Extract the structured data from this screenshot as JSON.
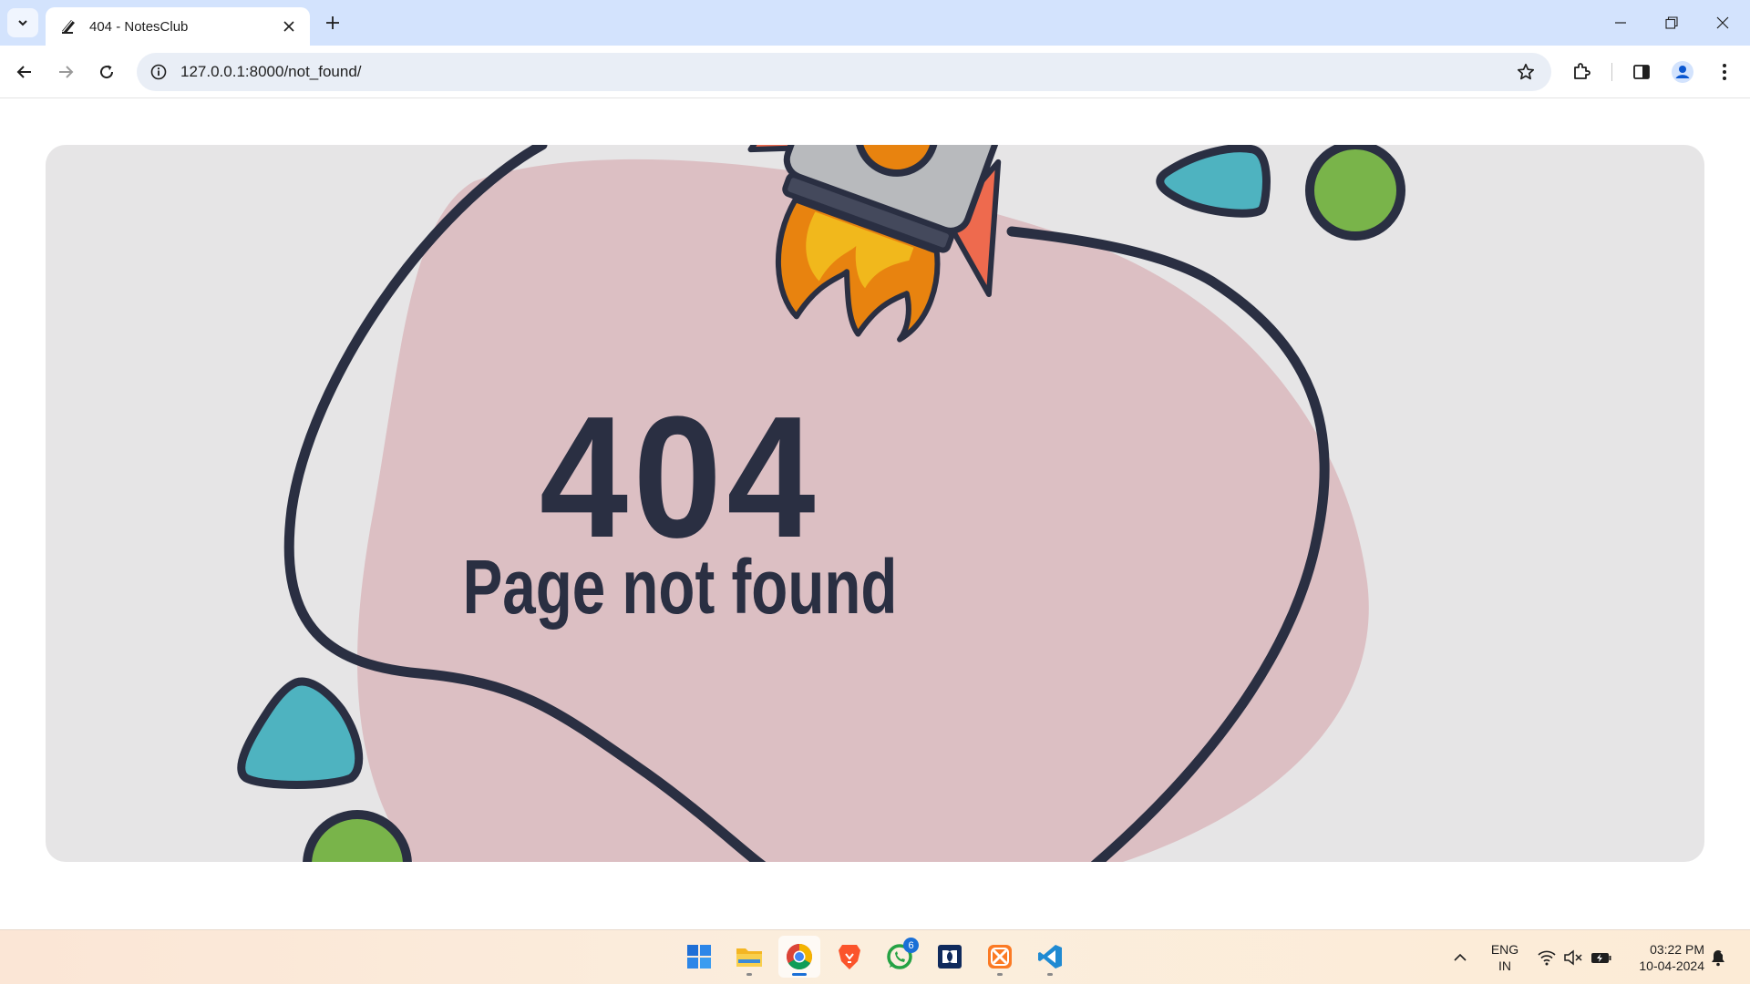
{
  "browser": {
    "tab": {
      "title": "404 - NotesClub"
    },
    "address": {
      "url": "127.0.0.1:8000/not_found/"
    }
  },
  "page": {
    "error_code": "404",
    "message": "Page not found",
    "colors": {
      "background": "#e6e5e6",
      "blob": "#dcbfc3",
      "ink": "#2a2f42",
      "teal": "#4eb3c0",
      "green": "#79b44a"
    }
  },
  "taskbar": {
    "apps": [
      {
        "name": "Start"
      },
      {
        "name": "File Explorer"
      },
      {
        "name": "Google Chrome"
      },
      {
        "name": "Brave"
      },
      {
        "name": "WhatsApp",
        "badge": "6"
      },
      {
        "name": "Dolby Access"
      },
      {
        "name": "XAMPP"
      },
      {
        "name": "Visual Studio Code"
      }
    ],
    "language": {
      "line1": "ENG",
      "line2": "IN"
    },
    "clock": {
      "time": "03:22 PM",
      "date": "10-04-2024"
    }
  }
}
